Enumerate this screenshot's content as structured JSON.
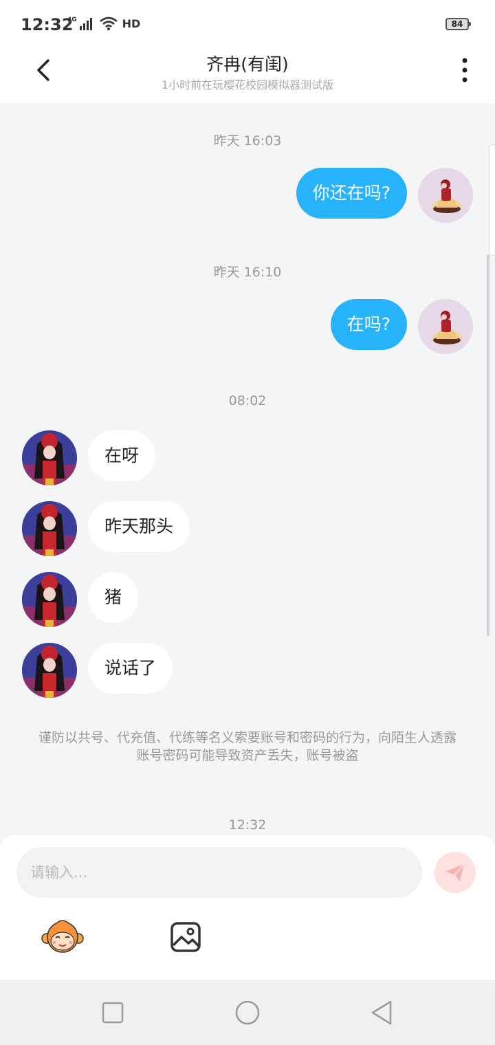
{
  "status": {
    "time": "12:32",
    "network": "4G",
    "hd": "HD",
    "battery": "84"
  },
  "header": {
    "title": "齐冉(有闺)",
    "subtitle": "1小时前在玩樱花校园模拟器测试版"
  },
  "messages": {
    "ts1": "昨天 16:03",
    "out1": "你还在吗?",
    "ts2": "昨天 16:10",
    "out2": "在吗?",
    "ts3": "08:02",
    "in1": "在呀",
    "in2": "昨天那头",
    "in3": "猪",
    "in4": "说话了"
  },
  "notice": "谨防以共号、代充值、代练等名义索要账号和密码的行为，向陌生人透露账号密码可能导致资产丢失，账号被盗",
  "ts4": "12:32",
  "input": {
    "placeholder": "请输入..."
  },
  "icons": {
    "back": "chevron-left-icon",
    "more": "more-vertical-icon",
    "send": "paper-plane-icon",
    "emoji": "monkey-face-icon",
    "image": "image-icon"
  },
  "colors": {
    "bubble_out": "#27b3fb",
    "bubble_in": "#ffffff",
    "send_bg": "#fde1e0",
    "send_icon": "#f6b4b0"
  }
}
